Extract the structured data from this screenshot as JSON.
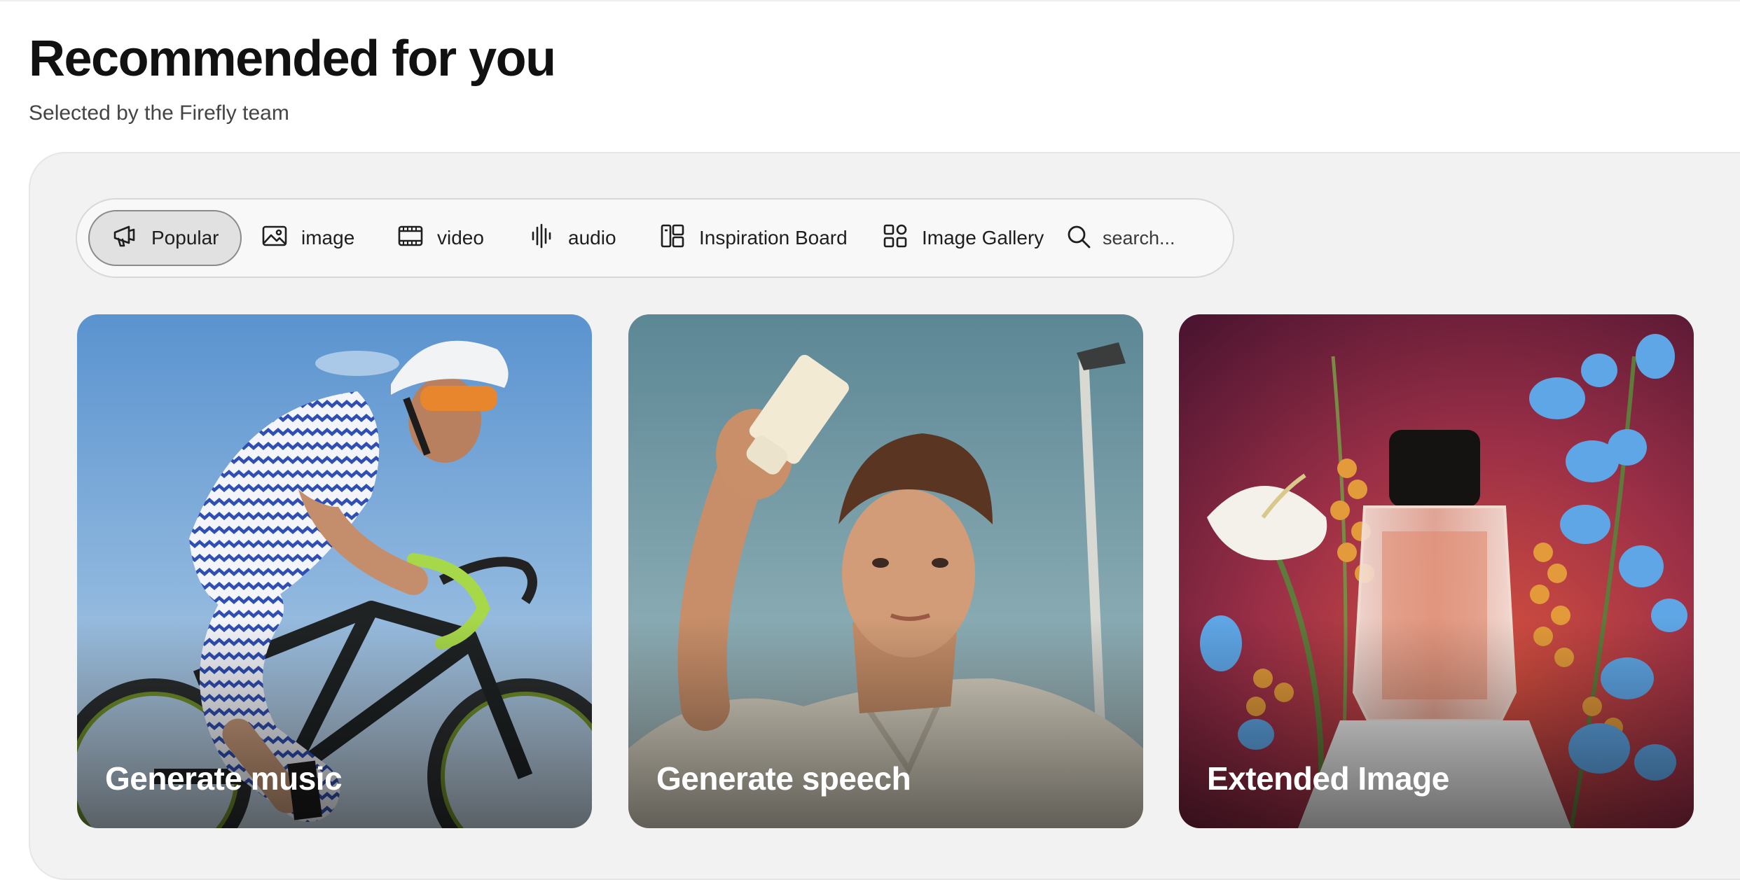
{
  "header": {
    "title": "Recommended for you",
    "subtitle": "Selected by the Firefly team"
  },
  "filters": [
    {
      "label": "Popular",
      "icon": "megaphone-icon",
      "active": true
    },
    {
      "label": "image",
      "icon": "image-icon",
      "active": false
    },
    {
      "label": "video",
      "icon": "video-film-icon",
      "active": false
    },
    {
      "label": "audio",
      "icon": "audio-waveform-icon",
      "active": false
    },
    {
      "label": "Inspiration Board",
      "icon": "board-icon",
      "active": false
    },
    {
      "label": "Image Gallery",
      "icon": "gallery-grid-icon",
      "active": false
    }
  ],
  "search": {
    "placeholder": "search...",
    "value": "",
    "icon": "search-icon"
  },
  "cards": [
    {
      "label": "Generate music",
      "image": "cyclist-photo"
    },
    {
      "label": "Generate speech",
      "image": "man-with-lotion-tube-photo"
    },
    {
      "label": "Extended Image",
      "image": "perfume-bottle-with-flowers-photo"
    }
  ],
  "colors": {
    "panel_bg": "#f2f2f2",
    "chip_active_bg": "#e1e1e1",
    "card_label": "#ffffff"
  }
}
